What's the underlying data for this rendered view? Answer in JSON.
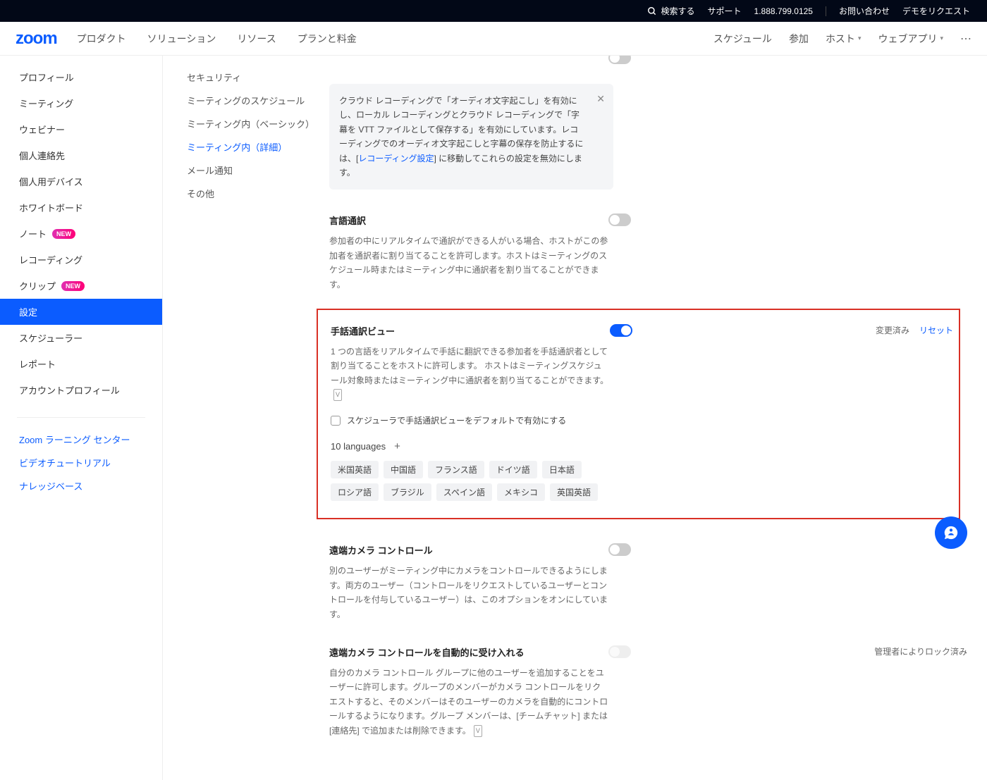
{
  "top_bar": {
    "search": "検索する",
    "support": "サポート",
    "phone": "1.888.799.0125",
    "contact": "お問い合わせ",
    "demo": "デモをリクエスト"
  },
  "nav": {
    "logo": "zoom",
    "products": "プロダクト",
    "solutions": "ソリューション",
    "resources": "リソース",
    "pricing": "プランと料金",
    "schedule": "スケジュール",
    "join": "参加",
    "host": "ホスト",
    "webapp": "ウェブアプリ"
  },
  "sidebar": {
    "items": [
      {
        "label": "プロフィール"
      },
      {
        "label": "ミーティング"
      },
      {
        "label": "ウェビナー"
      },
      {
        "label": "個人連絡先"
      },
      {
        "label": "個人用デバイス"
      },
      {
        "label": "ホワイトボード"
      },
      {
        "label": "ノート",
        "badge": "NEW"
      },
      {
        "label": "レコーディング"
      },
      {
        "label": "クリップ",
        "badge": "NEW"
      },
      {
        "label": "設定",
        "active": true
      },
      {
        "label": "スケジューラー"
      },
      {
        "label": "レポート"
      },
      {
        "label": "アカウントプロフィール"
      }
    ],
    "links": [
      "Zoom ラーニング センター",
      "ビデオチュートリアル",
      "ナレッジベース"
    ]
  },
  "tabs": [
    {
      "label": "セキュリティ"
    },
    {
      "label": "ミーティングのスケジュール"
    },
    {
      "label": "ミーティング内（ベーシック）"
    },
    {
      "label": "ミーティング内（詳細）",
      "active": true
    },
    {
      "label": "メール通知"
    },
    {
      "label": "その他"
    }
  ],
  "info": {
    "text_before": "クラウド レコーディングで「オーディオ文字起こし」を有効にし、ローカル レコーディングとクラウド レコーディングで「字幕を VTT ファイルとして保存する」を有効にしています。レコーディングでのオーディオ文字起こしと字幕の保存を防止するには、[",
    "link": "レコーディング設定",
    "text_after": "] に移動してこれらの設定を無効にします。"
  },
  "sec1": {
    "title": "言語通訳",
    "desc": "参加者の中にリアルタイムで通訳ができる人がいる場合、ホストがこの参加者を通訳者に割り当てることを許可します。ホストはミーティングのスケジュール時またはミーティング中に通訳者を割り当てることができます。"
  },
  "sec2": {
    "title": "手話通訳ビュー",
    "desc": "1 つの言語をリアルタイムで手話に翻訳できる参加者を手話通訳者として割り当てることをホストに許可します。 ホストはミーティングスケジュール対象時またはミーティング中に通訳者を割り当てることができます。",
    "checkbox": "スケジューラで手話通訳ビューをデフォルトで有効にする",
    "lang_count": "10 languages",
    "modified": "変更済み",
    "reset": "リセット",
    "tags": [
      "米国英語",
      "中国語",
      "フランス語",
      "ドイツ語",
      "日本語",
      "ロシア語",
      "ブラジル",
      "スペイン語",
      "メキシコ",
      "英国英語"
    ]
  },
  "sec3": {
    "title": "遠端カメラ コントロール",
    "desc": "別のユーザーがミーティング中にカメラをコントロールできるようにします。両方のユーザー（コントロールをリクエストしているユーザーとコントロールを付与しているユーザー）は、このオプションをオンにしています。"
  },
  "sec4": {
    "title": "遠端カメラ コントロールを自動的に受け入れる",
    "desc": "自分のカメラ コントロール グループに他のユーザーを追加することをユーザーに許可します。グループのメンバーがカメラ コントロールをリクエストすると、そのメンバーはそのユーザーのカメラを自動的にコントロールするようになります。グループ メンバーは、[チームチャット] または [連絡先] で追加または削除できます。",
    "locked": "管理者によりロック済み"
  }
}
